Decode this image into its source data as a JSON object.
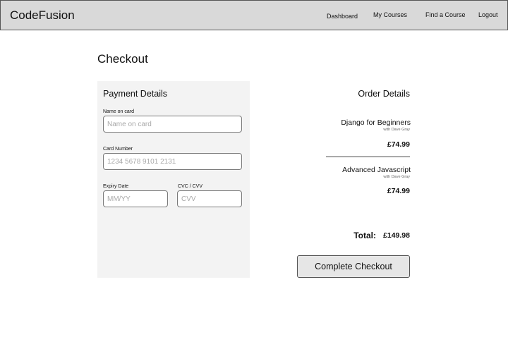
{
  "header": {
    "brand": "CodeFusion",
    "nav": {
      "dashboard": "Dashboard",
      "my_courses": "My Courses",
      "find_course": "Find a Course",
      "logout": "Logout"
    }
  },
  "page_title": "Checkout",
  "payment": {
    "title": "Payment Details",
    "name": {
      "label": "Name on card",
      "placeholder": "Name on card",
      "value": ""
    },
    "card_number": {
      "label": "Card Number",
      "placeholder": "1234 5678 9101 2131",
      "value": ""
    },
    "expiry": {
      "label": "Expiry Date",
      "placeholder": "MM/YY",
      "value": ""
    },
    "cvc": {
      "label": "CVC / CVV",
      "placeholder": "CVV",
      "value": ""
    }
  },
  "order": {
    "title": "Order Details",
    "items": [
      {
        "name": "Django for Beginners",
        "instructor": "with Dave Gray",
        "price": "£74.99"
      },
      {
        "name": "Advanced Javascript",
        "instructor": "with Dave Gray",
        "price": "£74.99"
      }
    ],
    "total_label": "Total:",
    "total_value": "£149.98"
  },
  "actions": {
    "complete_checkout": "Complete Checkout"
  }
}
